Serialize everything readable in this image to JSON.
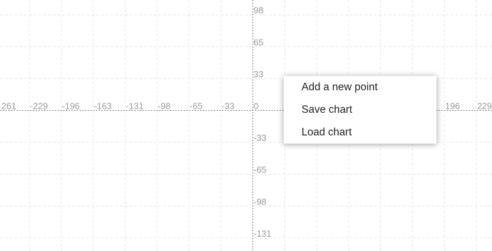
{
  "axes": {
    "x_ticks": [
      "261",
      "-229",
      "-196",
      "-163",
      "-131",
      "-98",
      "-65",
      "-33",
      "0",
      "196",
      "229"
    ],
    "y_ticks": [
      "98",
      "65",
      "33",
      "-33",
      "-65",
      "-98",
      "-131"
    ]
  },
  "context_menu": {
    "items": [
      {
        "label": "Add a new point"
      },
      {
        "label": "Save chart"
      },
      {
        "label": "Load chart"
      }
    ]
  }
}
